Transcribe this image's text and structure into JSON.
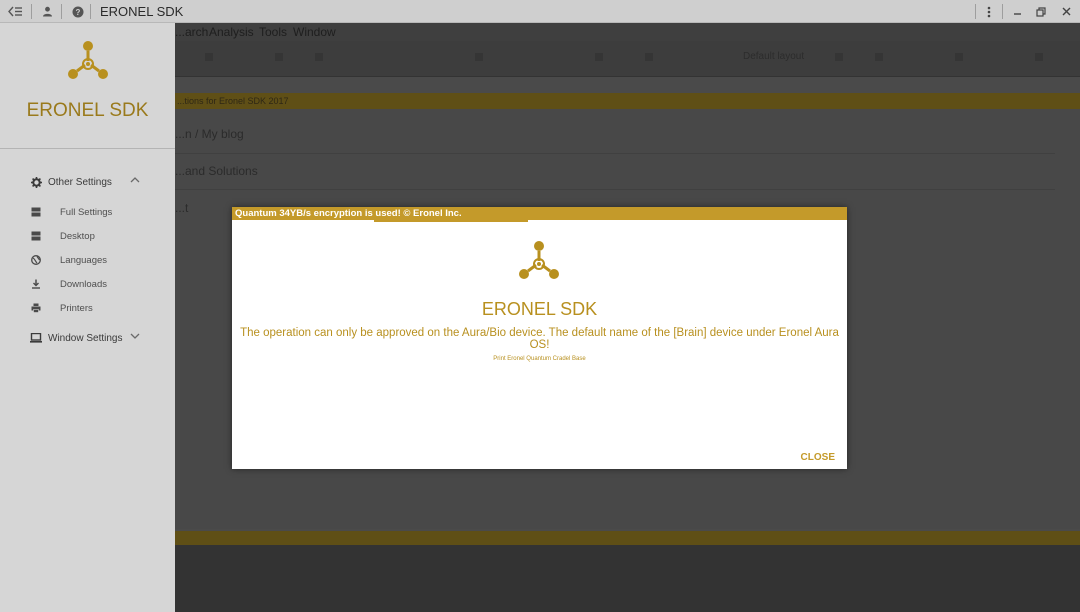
{
  "window": {
    "title": "ERONEL SDK",
    "controls": [
      "menu-icon",
      "minimize-icon",
      "restore-icon",
      "close-icon"
    ]
  },
  "menubar": {
    "items": [
      "...arch",
      "Analysis",
      "Tools",
      "Window"
    ]
  },
  "toolbar": {
    "combo_label": "Default layout"
  },
  "document": {
    "header": "...tions for Eronel SDK 2017",
    "rows": [
      "...n / My blog",
      "...and Solutions",
      "...t"
    ]
  },
  "sidebar": {
    "brand": "ERONEL SDK",
    "sections": [
      {
        "label": "Other Settings",
        "icon": "gear-icon",
        "expanded": true,
        "items": [
          {
            "label": "Full Settings",
            "icon": "server-icon"
          },
          {
            "label": "Desktop",
            "icon": "server-icon"
          },
          {
            "label": "Languages",
            "icon": "globe-icon"
          },
          {
            "label": "Downloads",
            "icon": "download-icon"
          },
          {
            "label": "Printers",
            "icon": "printer-icon"
          }
        ]
      },
      {
        "label": "Window Settings",
        "icon": "laptop-icon",
        "expanded": false,
        "items": []
      }
    ]
  },
  "dialog": {
    "header": "Quantum 34YB/s encryption is used! © Eronel Inc.",
    "title": "ERONEL SDK",
    "message": "The operation can only be approved on the Aura/Bio device. The default name of the [Brain] device under Eronel Aura OS!",
    "small_text": "Print Eronel Quantum Cradel Base",
    "close_label": "CLOSE",
    "progress": 0.25
  },
  "colors": {
    "accent": "#c49a2a",
    "accent_text": "#b8901f",
    "sidebar_bg": "#d6d6d6",
    "titlebar_bg": "#cfcfcf"
  }
}
